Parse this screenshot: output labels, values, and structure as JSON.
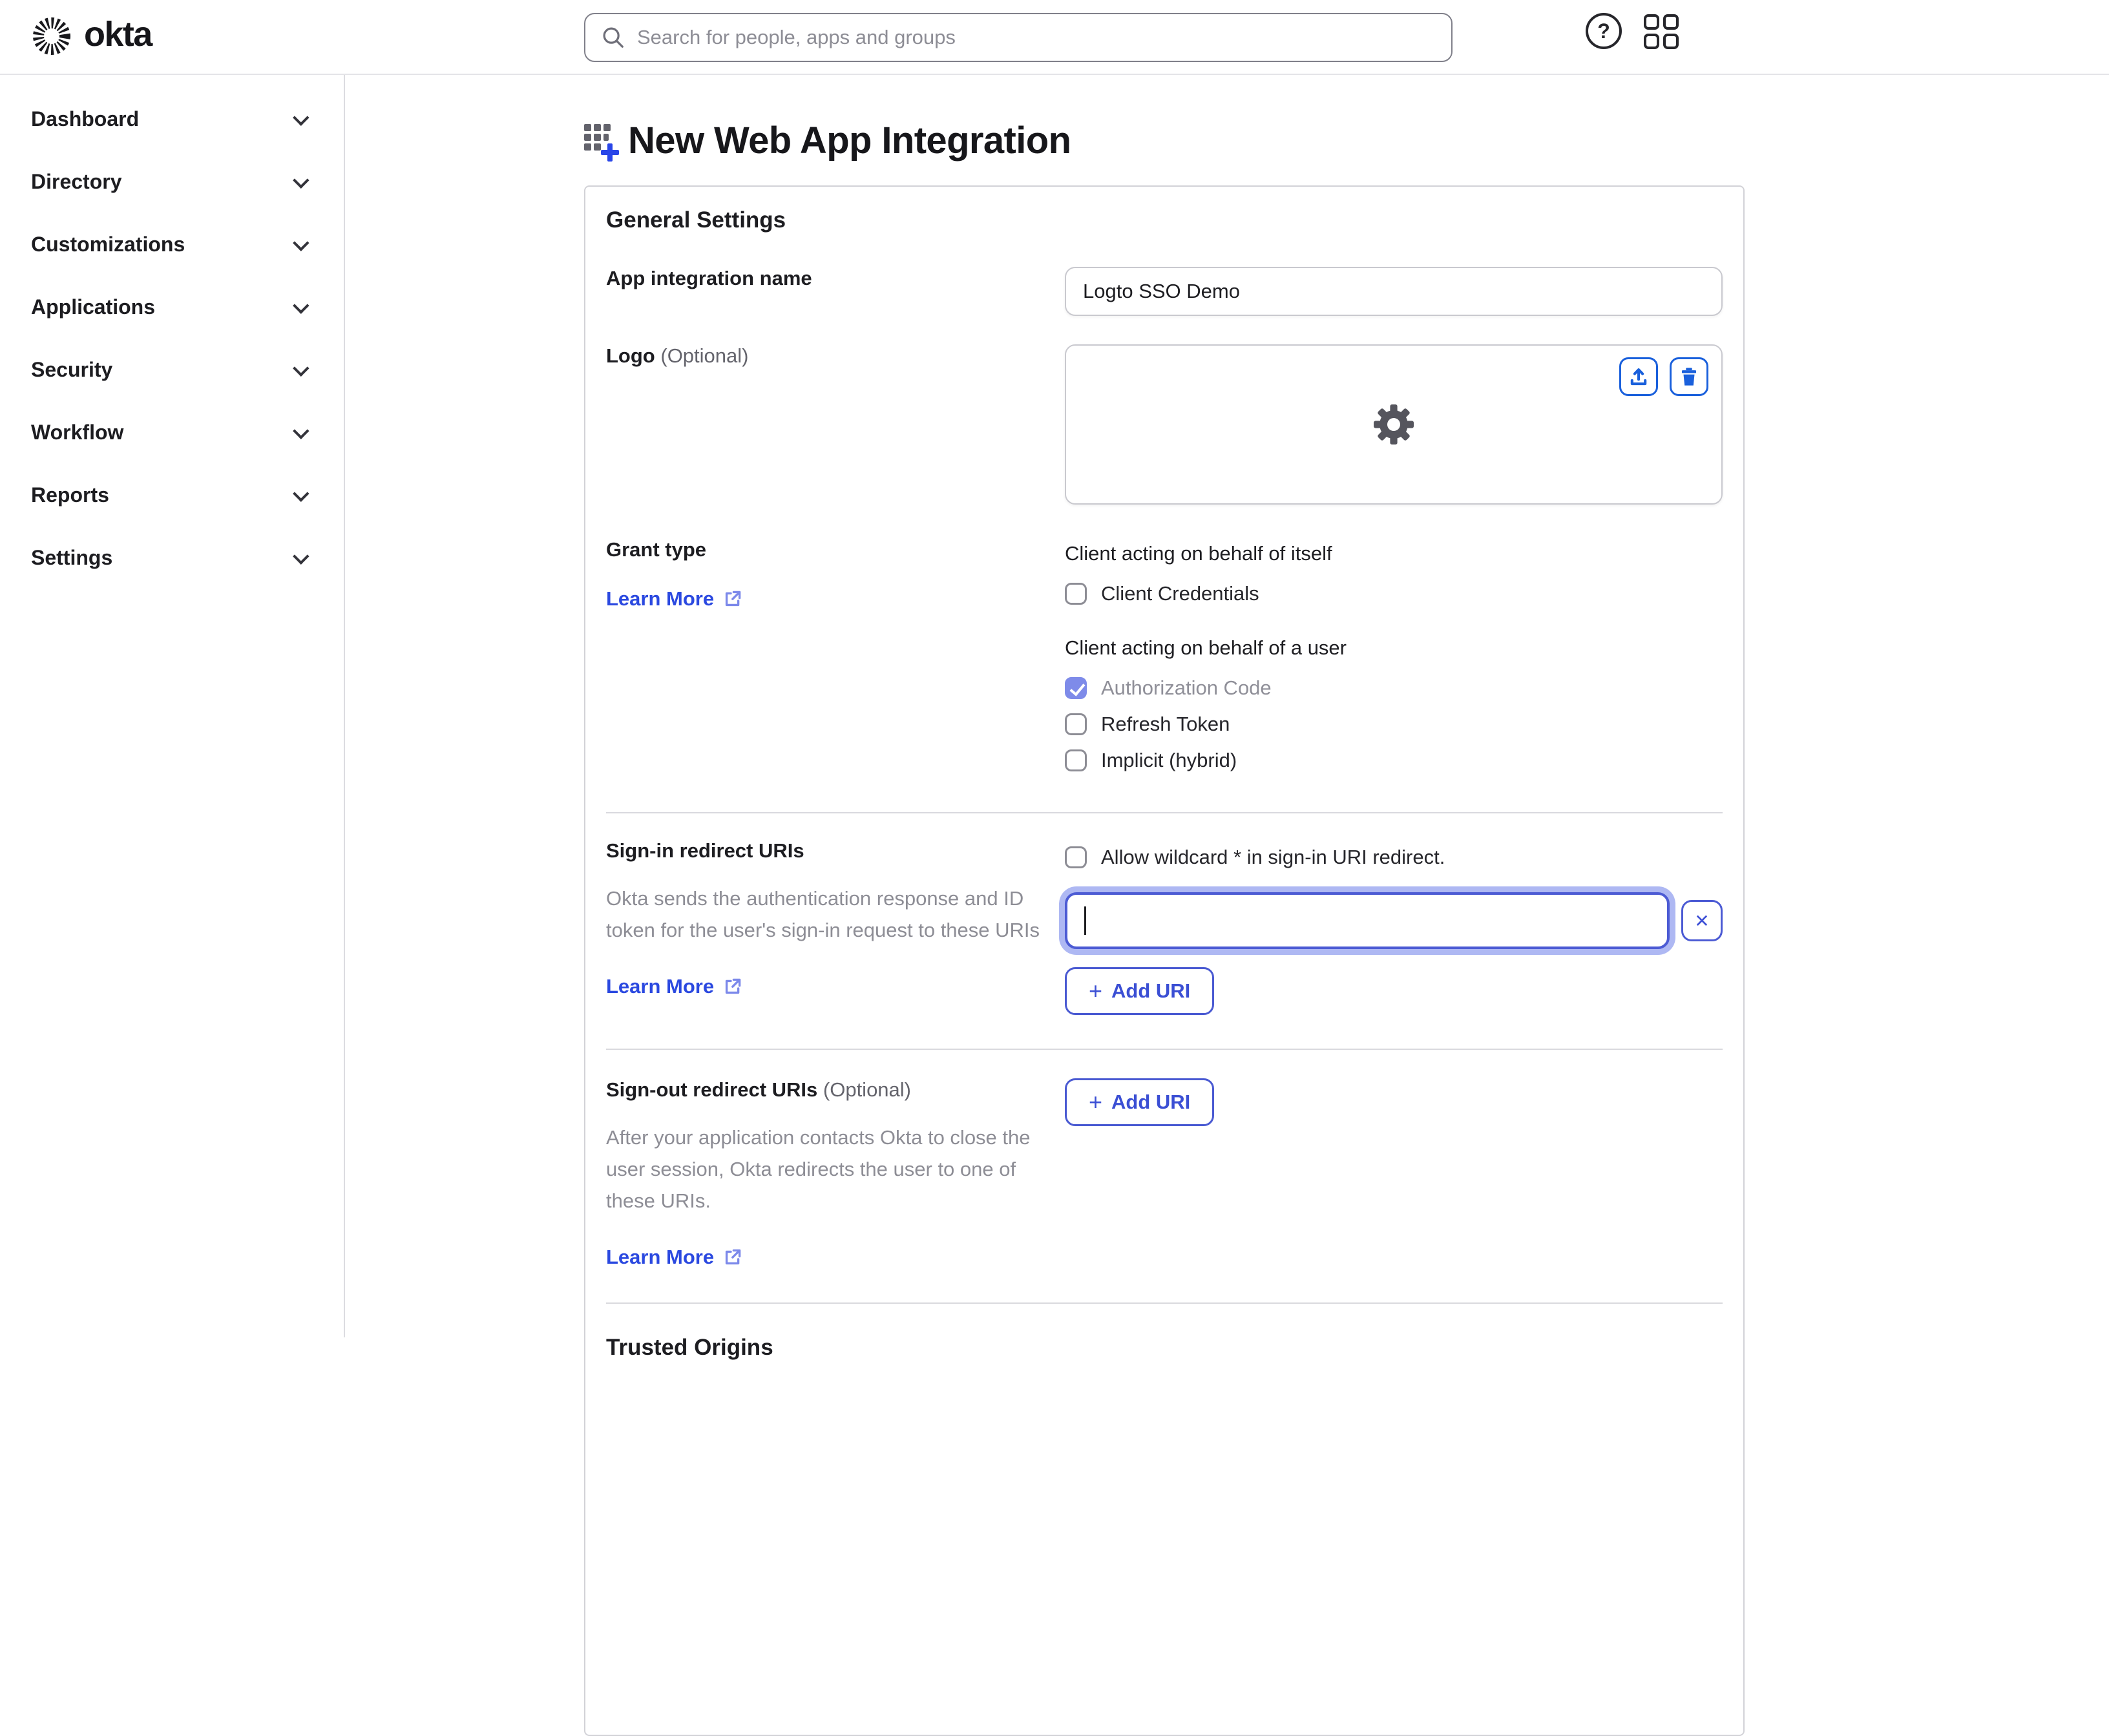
{
  "header": {
    "brand": "okta",
    "search_placeholder": "Search for people, apps and groups"
  },
  "icons": {
    "question_mark": "?",
    "close": "✕",
    "plus": "+"
  },
  "sidebar": {
    "items": [
      {
        "label": "Dashboard"
      },
      {
        "label": "Directory"
      },
      {
        "label": "Customizations"
      },
      {
        "label": "Applications"
      },
      {
        "label": "Security"
      },
      {
        "label": "Workflow"
      },
      {
        "label": "Reports"
      },
      {
        "label": "Settings"
      }
    ]
  },
  "main": {
    "title": "New Web App Integration"
  },
  "form": {
    "section_title": "General Settings",
    "app_name_label": "App integration name",
    "app_name_value": "Logto SSO Demo",
    "logo_label": "Logo",
    "logo_optional": "(Optional)",
    "grant_label": "Grant type",
    "learn_more": "Learn More",
    "grant_itself_heading": "Client acting on behalf of itself",
    "grant_user_heading": "Client acting on behalf of a user",
    "grant_options": [
      {
        "label": "Client Credentials",
        "checked": false
      },
      {
        "label": "Authorization Code",
        "checked": true
      },
      {
        "label": "Refresh Token",
        "checked": false
      },
      {
        "label": "Implicit (hybrid)",
        "checked": false
      }
    ],
    "signin_label": "Sign-in redirect URIs",
    "signin_wildcard": "Allow wildcard * in sign-in URI redirect.",
    "signin_description": "Okta sends the authentication response and ID token for the user's sign-in request to these URIs",
    "signin_uri_value": "",
    "add_uri_label": "Add URI",
    "signout_label": "Sign-out redirect URIs",
    "signout_optional": "(Optional)",
    "signout_description": "After your application contacts Okta to close the user session, Okta redirects the user to one of these URIs.",
    "trusted_origins_title": "Trusted Origins"
  },
  "colors": {
    "link_blue": "#2b49e0",
    "outline_indigo": "#4c5bd4",
    "action_blue": "#1a60dc",
    "checked_checkbox": "#7e8be9",
    "focus_ring": "#aeb8f3"
  }
}
